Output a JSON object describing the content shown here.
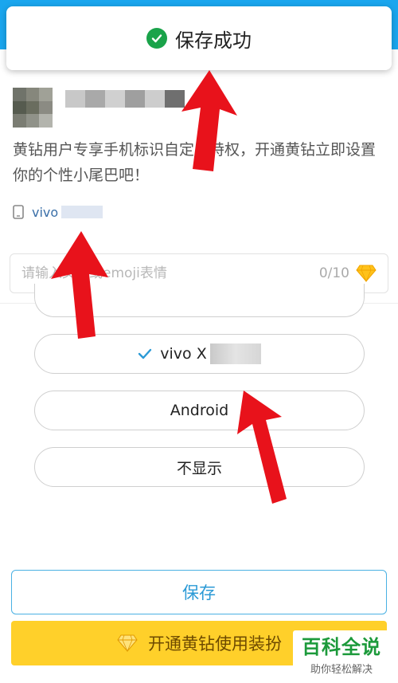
{
  "toast": {
    "message": "保存成功"
  },
  "promo": {
    "text": "黄钻用户专享手机标识自定义特权，开通黄钻立即设置你的个性小尾巴吧！"
  },
  "device_preview": {
    "label": "vivo"
  },
  "tail_input": {
    "value": "",
    "placeholder": "请输入文字或emoji表情",
    "count": "0/10"
  },
  "options": [
    {
      "label": ""
    },
    {
      "label": "vivo X",
      "selected": true
    },
    {
      "label": "Android"
    },
    {
      "label": "不显示"
    }
  ],
  "actions": {
    "save": "保存",
    "open_vip": "开通黄钻使用装扮"
  },
  "watermark": {
    "title": "百科全说",
    "subtitle": "助你轻松解决"
  },
  "colors": {
    "header": "#1aa6ee",
    "accent": "#2b9ad6",
    "success": "#1aa34a",
    "vip": "#ffd02a",
    "annotation": "#e8121b"
  }
}
